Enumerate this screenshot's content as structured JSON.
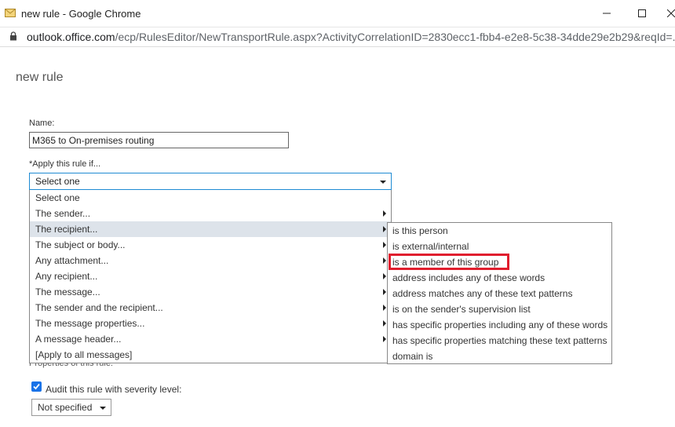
{
  "window": {
    "title": "new rule - Google Chrome",
    "url_host": "outlook.office.com",
    "url_path": "/ecp/RulesEditor/NewTransportRule.aspx?ActivityCorrelationID=2830ecc1-fbb4-e2e8-5c38-34dde29e2b29&reqId=..."
  },
  "page": {
    "title": "new rule",
    "name_label": "Name:",
    "name_value": "M365 to On-premises routing",
    "apply_label": "*Apply this rule if...",
    "apply_selected": "Select one"
  },
  "dropdown": {
    "items": [
      {
        "label": "Select one",
        "submenu": false
      },
      {
        "label": "The sender...",
        "submenu": true
      },
      {
        "label": "The recipient...",
        "submenu": true
      },
      {
        "label": "The subject or body...",
        "submenu": true
      },
      {
        "label": "Any attachment...",
        "submenu": true
      },
      {
        "label": "Any recipient...",
        "submenu": true
      },
      {
        "label": "The message...",
        "submenu": true
      },
      {
        "label": "The sender and the recipient...",
        "submenu": true
      },
      {
        "label": "The message properties...",
        "submenu": true
      },
      {
        "label": "A message header...",
        "submenu": true
      },
      {
        "label": "[Apply to all messages]",
        "submenu": false
      }
    ],
    "selected_index": 2
  },
  "submenu": {
    "items": [
      "is this person",
      "is external/internal",
      "is a member of this group",
      "address includes any of these words",
      "address matches any of these text patterns",
      "is on the sender's supervision list",
      "has specific properties including any of these words",
      "has specific properties matching these text patterns",
      "domain is"
    ],
    "highlighted_index": 2
  },
  "footer": {
    "properties_label": "Properties of this rule:",
    "audit_label": "Audit this rule with severity level:",
    "audit_checked": true,
    "severity_value": "Not specified"
  },
  "colors": {
    "highlight": "#e01e2e",
    "focus_border": "#1e8bd3",
    "checkbox": "#1a73e8",
    "selected_row": "#dde3ea"
  }
}
